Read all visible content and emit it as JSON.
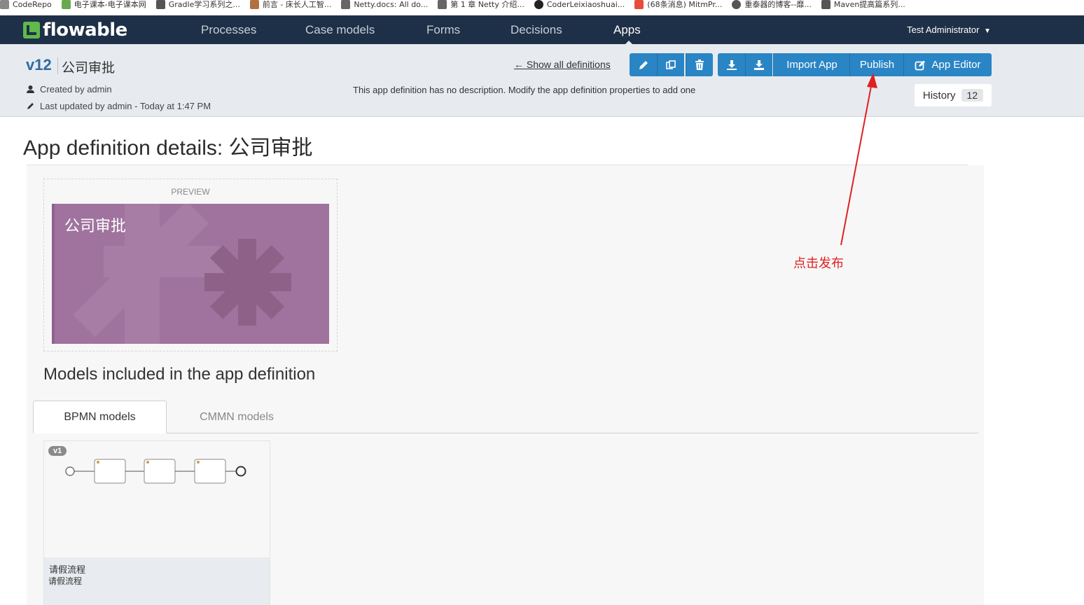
{
  "bookmarks": [
    {
      "label": "CodeRepo",
      "color": "#888888"
    },
    {
      "label": "电子课本-电子课本网",
      "color": "#6aa84f"
    },
    {
      "label": "Gradle学习系列之...",
      "color": "#555555"
    },
    {
      "label": "前言 - 床长人工智...",
      "color": "#b07040"
    },
    {
      "label": "Netty.docs: All do...",
      "color": "#666666"
    },
    {
      "label": "第 1 章 Netty 介绍...",
      "color": "#666666"
    },
    {
      "label": "CoderLeixiaoshuai...",
      "color": "#222222"
    },
    {
      "label": "(68条消息) MitmPr...",
      "color": "#e84c3d"
    },
    {
      "label": "重泰器的博客--靡...",
      "color": "#555555"
    },
    {
      "label": "Maven提高篇系列...",
      "color": "#555555"
    }
  ],
  "nav": {
    "brand": "flowable",
    "items": [
      "Processes",
      "Case models",
      "Forms",
      "Decisions",
      "Apps"
    ],
    "active": "Apps",
    "user": "Test Administrator"
  },
  "header": {
    "version": "v12",
    "app_name": "公司审批",
    "created_by": "Created by admin",
    "updated_by": "Last updated by admin - Today at 1:47 PM",
    "description": "This app definition has no description. Modify the app definition properties to add one",
    "show_all": "← Show all definitions",
    "import_label": "Import App",
    "publish_label": "Publish",
    "app_editor_label": "App Editor",
    "history_label": "History",
    "history_count": "12"
  },
  "main": {
    "title": "App definition details: 公司审批",
    "preview_label": "PREVIEW",
    "tile_title": "公司审批",
    "tile_color": "#a0739e",
    "models_title": "Models included in the app definition",
    "tabs": [
      "BPMN models",
      "CMMN models"
    ],
    "active_tab": "BPMN models",
    "models": [
      {
        "version": "v1",
        "name": "请假流程",
        "description": "请假流程"
      }
    ]
  },
  "annotation": {
    "text": "点击发布",
    "color": "#e02020"
  },
  "colors": {
    "nav_bg": "#1e3047",
    "header_bg": "#e7ebef",
    "button_blue": "#2a85c5",
    "version_blue": "#2d6ca2"
  }
}
